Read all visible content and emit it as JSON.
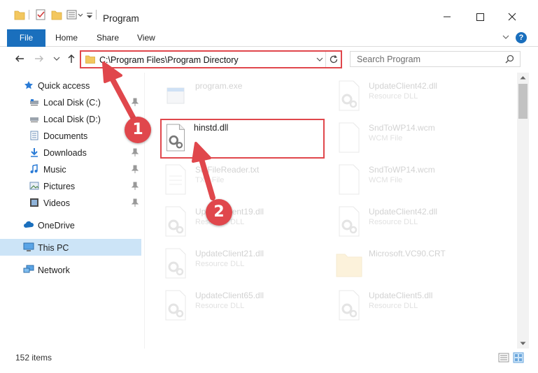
{
  "window": {
    "title": "Program",
    "minimize_glyph": "—",
    "maximize_glyph": "☐",
    "close_glyph": "✕"
  },
  "ribbon": {
    "file_tab": "File",
    "tabs": [
      "Home",
      "Share",
      "View"
    ],
    "help_glyph": "?"
  },
  "address": {
    "path": "C:\\Program Files\\Program Directory"
  },
  "search": {
    "placeholder": "Search Program"
  },
  "sidebar": {
    "items": [
      {
        "label": "Quick access",
        "icon": "star-icon",
        "pinned": false
      },
      {
        "label": "Local Disk (C:)",
        "icon": "drive-icon",
        "pinned": true
      },
      {
        "label": "Local Disk (D:)",
        "icon": "drive-icon",
        "pinned": false
      },
      {
        "label": "Documents",
        "icon": "documents-icon",
        "pinned": true
      },
      {
        "label": "Downloads",
        "icon": "download-icon",
        "pinned": true
      },
      {
        "label": "Music",
        "icon": "music-icon",
        "pinned": true
      },
      {
        "label": "Pictures",
        "icon": "pictures-icon",
        "pinned": true
      },
      {
        "label": "Videos",
        "icon": "videos-icon",
        "pinned": true
      },
      {
        "label": "OneDrive",
        "icon": "cloud-icon",
        "pinned": false
      },
      {
        "label": "This PC",
        "icon": "computer-icon",
        "pinned": false,
        "selected": true
      },
      {
        "label": "Network",
        "icon": "network-icon",
        "pinned": false
      }
    ]
  },
  "files": [
    {
      "name": "program.exe",
      "type": "",
      "icon": "exe-icon",
      "faded": true
    },
    {
      "name": "UpdateClient42.dll",
      "type": "Resource DLL",
      "icon": "dll-icon",
      "faded": true
    },
    {
      "name": "hinstd.dll",
      "type": "",
      "icon": "dll-icon",
      "faded": false
    },
    {
      "name": "SndToWP14.wcm",
      "type": "WCM File",
      "icon": "blank-file-icon",
      "faded": true
    },
    {
      "name": "SlnFileReader.txt",
      "type": "TXT File",
      "icon": "text-file-icon",
      "faded": true
    },
    {
      "name": "SndToWP14.wcm",
      "type": "WCM File",
      "icon": "blank-file-icon",
      "faded": true
    },
    {
      "name": "UpdateClient19.dll",
      "type": "Resource DLL",
      "icon": "dll-icon",
      "faded": true
    },
    {
      "name": "UpdateClient42.dll",
      "type": "Resource DLL",
      "icon": "dll-icon",
      "faded": true
    },
    {
      "name": "UpdateClient21.dll",
      "type": "Resource DLL",
      "icon": "dll-icon",
      "faded": true
    },
    {
      "name": "Microsoft.VC90.CRT",
      "type": "",
      "icon": "folder-icon",
      "faded": true
    },
    {
      "name": "UpdateClient65.dll",
      "type": "Resource DLL",
      "icon": "dll-icon",
      "faded": true
    },
    {
      "name": "UpdateClient5.dll",
      "type": "Resource DLL",
      "icon": "dll-icon",
      "faded": true
    }
  ],
  "status": {
    "item_count": "152 items"
  },
  "annotations": {
    "step1": "1",
    "step2": "2",
    "color": "#e0474c"
  }
}
